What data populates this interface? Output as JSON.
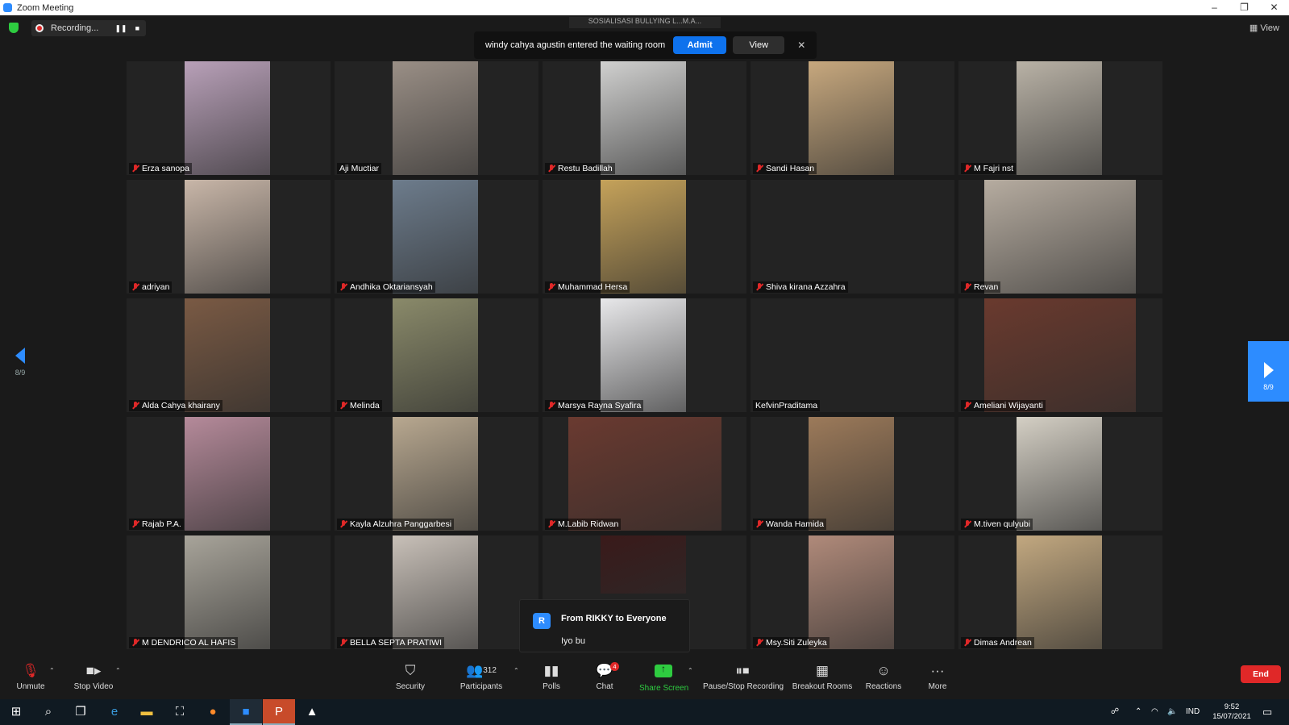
{
  "window": {
    "title": "Zoom Meeting",
    "controls": [
      "–",
      "❐",
      "✕"
    ]
  },
  "topbar": {
    "recording_label": "Recording...",
    "view_label": "View",
    "meeting_topic": "SOSIALISASI BULLYING L...M.A..."
  },
  "notification": {
    "text": "windy cahya agustin entered the waiting room",
    "admit_label": "Admit",
    "view_label": "View",
    "close": "✕"
  },
  "pagination": {
    "left": "8/9",
    "right": "8/9"
  },
  "participants": [
    {
      "name": "Erza sanopa",
      "muted": true,
      "bg": "#b8a0b8"
    },
    {
      "name": "Aji Muctiar",
      "muted": false,
      "bg": "#9a8f86"
    },
    {
      "name": "Restu Badillah",
      "muted": true,
      "bg": "#d0d0cf"
    },
    {
      "name": "Sandi Hasan",
      "muted": true,
      "bg": "#c7a87e"
    },
    {
      "name": "M Fajri nst",
      "muted": true,
      "bg": "#b9b2a6"
    },
    {
      "name": "adriyan",
      "muted": true,
      "bg": "#c8b6a8"
    },
    {
      "name": "Andhika Oktariansyah",
      "muted": true,
      "bg": "#6d7c8c"
    },
    {
      "name": "Muhammad Hersa",
      "muted": true,
      "bg": "#c5a25a"
    },
    {
      "name": "Shiva kirana Azzahra",
      "muted": true,
      "bg": ""
    },
    {
      "name": "Revan",
      "muted": true,
      "bg": "#b6aca0"
    },
    {
      "name": "Alda Cahya khairany",
      "muted": true,
      "bg": "#7a5a44"
    },
    {
      "name": "Melinda",
      "muted": true,
      "bg": "#8a8a6a"
    },
    {
      "name": "Marsya Rayna Syafira",
      "muted": true,
      "bg": "#e8e8ea"
    },
    {
      "name": "KefvinPraditama",
      "muted": false,
      "bg": ""
    },
    {
      "name": "Ameliani Wijayanti",
      "muted": true,
      "bg": "#6a3a2e"
    },
    {
      "name": "Rajab P.A.",
      "muted": true,
      "bg": "#b58a9a"
    },
    {
      "name": "Kayla Alzuhra Panggarbesi",
      "muted": true,
      "bg": "#b8a890"
    },
    {
      "name": "M.Labib Ridwan",
      "muted": true,
      "bg": "#6a3a30"
    },
    {
      "name": "Wanda Hamida",
      "muted": true,
      "bg": "#9c7a5a"
    },
    {
      "name": "M.tiven qulyubi",
      "muted": true,
      "bg": "#d4cfc4"
    },
    {
      "name": "M DENDRICO AL HAFIS",
      "muted": true,
      "bg": "#a8a49a"
    },
    {
      "name": "BELLA SEPTA PRATIWI",
      "muted": true,
      "bg": "#c8c0b8"
    },
    {
      "name": "",
      "muted": false,
      "bg": "#3a1a1a"
    },
    {
      "name": "Msy.Siti Zuleyka",
      "muted": true,
      "bg": "#b08a7a"
    },
    {
      "name": "Dimas Andrean",
      "muted": true,
      "bg": "#c2a880"
    }
  ],
  "chat_toast": {
    "avatar": "R",
    "from": "From RIKKY to Everyone",
    "message": "Iyo bu"
  },
  "toolbar": {
    "unmute": "Unmute",
    "stop_video": "Stop Video",
    "security": "Security",
    "participants": "Participants",
    "participants_count": "312",
    "polls": "Polls",
    "chat": "Chat",
    "chat_badge": "4",
    "share_screen": "Share Screen",
    "pause_stop_recording": "Pause/Stop Recording",
    "breakout_rooms": "Breakout Rooms",
    "reactions": "Reactions",
    "more": "More",
    "end": "End"
  },
  "taskbar": {
    "language": "IND",
    "time": "9:52",
    "date": "15/07/2021"
  },
  "colors": {
    "accent": "#2d8cff",
    "end": "#e02828",
    "share": "#2ecc40"
  }
}
